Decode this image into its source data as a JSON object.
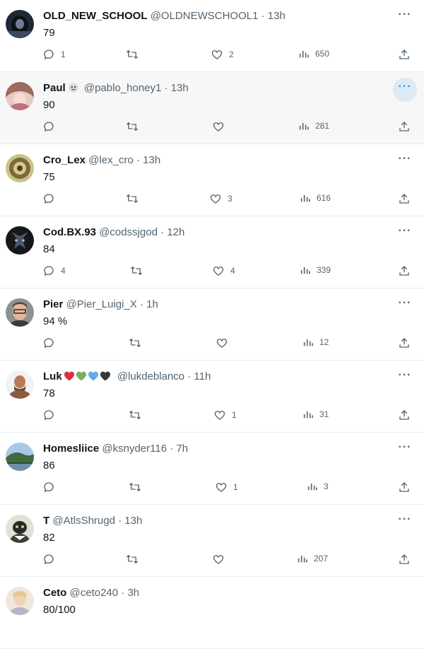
{
  "colors": {
    "secondary_text": "#536471",
    "accent": "#1d9bf0",
    "hover_bg": "#f7f7f7"
  },
  "icons": [
    "reply-icon",
    "retweet-icon",
    "like-icon",
    "views-icon",
    "share-icon",
    "more-icon"
  ],
  "tweets": [
    {
      "name": "OLD_NEW_SCHOOL",
      "handle": "@OLDNEWSCHOOL1",
      "dot": "·",
      "time": "13h",
      "text": "79",
      "replies": "1",
      "retweets": "",
      "likes": "2",
      "views": "650"
    },
    {
      "name": "Paul",
      "name_badge_icon": "smiling-face-icon",
      "handle": "@pablo_honey1",
      "dot": "·",
      "time": "13h",
      "text": "90",
      "replies": "",
      "retweets": "",
      "likes": "",
      "views": "281",
      "hovered": true
    },
    {
      "name": "Cro_Lex",
      "handle": "@lex_cro",
      "dot": "·",
      "time": "13h",
      "text": "75",
      "replies": "",
      "retweets": "",
      "likes": "3",
      "views": "616"
    },
    {
      "name": "Cod.BX.93",
      "handle": "@codssjgod",
      "dot": "·",
      "time": "12h",
      "text": "84",
      "replies": "4",
      "retweets": "",
      "likes": "4",
      "views": "339"
    },
    {
      "name": "Pier",
      "handle": "@Pier_Luigi_X",
      "dot": "·",
      "time": "1h",
      "text": "94 %",
      "replies": "",
      "retweets": "",
      "likes": "",
      "views": "12"
    },
    {
      "name": "Luk",
      "name_emojis": [
        "#dd2e44",
        "#78b159",
        "#5dadec",
        "#31373d"
      ],
      "handle": "@lukdeblanco",
      "dot": "·",
      "time": "11h",
      "text": "78",
      "replies": "",
      "retweets": "",
      "likes": "1",
      "views": "31"
    },
    {
      "name": "Homesliice",
      "handle": "@ksnyder116",
      "dot": "·",
      "time": "7h",
      "text": "86",
      "replies": "",
      "retweets": "",
      "likes": "1",
      "views": "3"
    },
    {
      "name": "T",
      "handle": "@AtlsShrugd",
      "dot": "·",
      "time": "13h",
      "text": "82",
      "replies": "",
      "retweets": "",
      "likes": "",
      "views": "207"
    },
    {
      "name": "Ceto",
      "handle": "@ceto240",
      "dot": "·",
      "time": "3h",
      "text": "80/100",
      "replies": "",
      "retweets": "",
      "likes": "",
      "views": ""
    }
  ]
}
